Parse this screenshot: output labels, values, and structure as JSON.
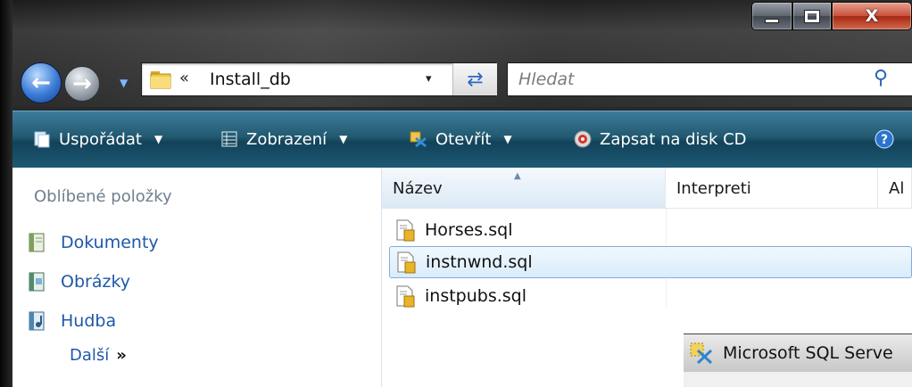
{
  "window": {
    "caption": {
      "minimize": "minimize",
      "maximize": "maximize",
      "close_label": "X"
    }
  },
  "address_bar": {
    "chevron": "«",
    "path": "Install_db",
    "dropdown": "▾",
    "refresh_icon": "refresh-icon"
  },
  "search": {
    "placeholder": "Hledat"
  },
  "command_bar": {
    "items": [
      {
        "label": "Uspořádat",
        "has_caret": true
      },
      {
        "label": "Zobrazení",
        "has_caret": true
      },
      {
        "label": "Otevřít",
        "has_caret": true
      },
      {
        "label": "Zapsat na disk CD",
        "has_caret": false
      }
    ],
    "help": "?"
  },
  "nav_pane": {
    "title": "Oblíbené položky",
    "items": [
      {
        "label": "Dokumenty",
        "icon": "documents-icon"
      },
      {
        "label": "Obrázky",
        "icon": "pictures-icon"
      },
      {
        "label": "Hudba",
        "icon": "music-icon"
      }
    ],
    "more_label": "Další",
    "more_glyph": "»"
  },
  "file_list": {
    "columns": [
      "Název",
      "Interpreti",
      "Al"
    ],
    "files": [
      {
        "name": "Horses.sql",
        "selected": false
      },
      {
        "name": "instnwnd.sql",
        "selected": true
      },
      {
        "name": "instpubs.sql",
        "selected": false
      }
    ]
  },
  "sql_window": {
    "title": "Microsoft SQL Serve"
  },
  "colors": {
    "command_bar": "#21596f",
    "link_blue": "#1f58a8",
    "close_red": "#c9503a",
    "selection": "#d9ecfb"
  }
}
